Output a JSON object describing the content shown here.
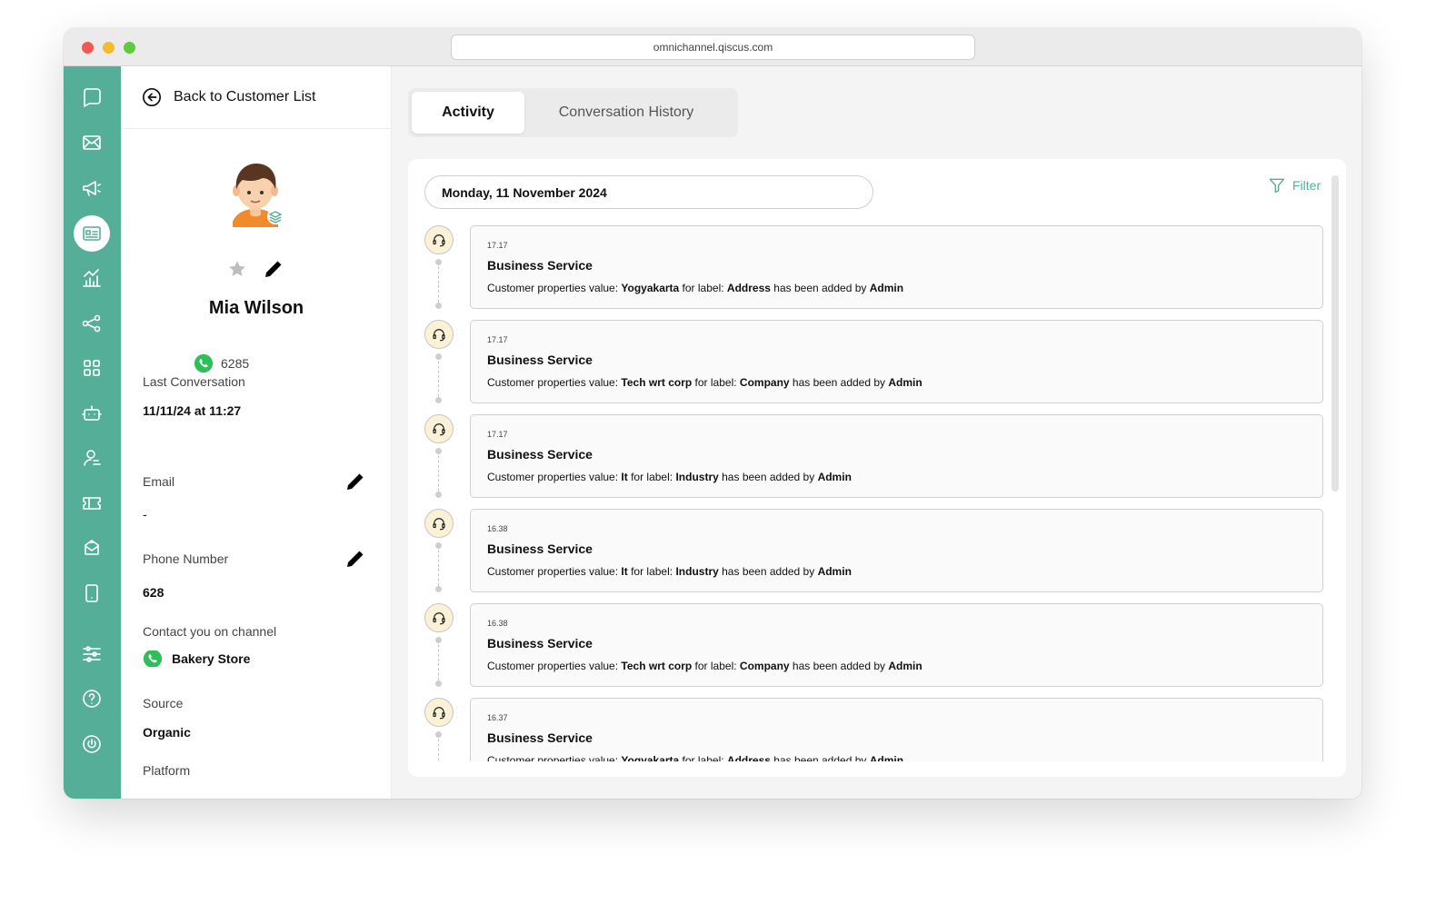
{
  "browser": {
    "url": "omnichannel.qiscus.com"
  },
  "colors": {
    "brand": "#55ae98",
    "rail": "#55ae98",
    "badge_bg": "#fbf1d6"
  },
  "rail": {
    "icons": [
      "chat-bubble-icon",
      "inbox-icon",
      "megaphone-icon",
      "contact-card-icon",
      "analytics-icon",
      "integration-icon",
      "apps-grid-icon",
      "bot-icon",
      "agent-icon",
      "ticket-icon",
      "mailbox-icon",
      "mobile-icon",
      "settings-sliders-icon",
      "help-icon",
      "power-icon"
    ],
    "active": "contact-card-icon"
  },
  "customer": {
    "back_label": "Back to Customer List",
    "name": "Mia Wilson",
    "phone_short": "6285",
    "last_conversation_label": "Last Conversation",
    "last_conversation_value": "11/11/24 at 11:27",
    "email_label": "Email",
    "email_value": "-",
    "phone_label": "Phone Number",
    "phone_value": "628",
    "channel_label": "Contact you on channel",
    "channel_value": "Bakery Store",
    "source_label": "Source",
    "source_value": "Organic",
    "platform_label": "Platform",
    "platform_value": "-"
  },
  "tabs": {
    "activity": "Activity",
    "history": "Conversation History",
    "active": "Activity"
  },
  "activity": {
    "date": "Monday, 11 November 2024",
    "filter_label": "Filter",
    "prefix": "Customer properties value: ",
    "for_label": " for label: ",
    "suffix": " has been added by ",
    "entries": [
      {
        "time": "17.17",
        "title": "Business Service",
        "value": "Yogyakarta",
        "label": "Address",
        "by": "Admin"
      },
      {
        "time": "17.17",
        "title": "Business Service",
        "value": "Tech wrt corp",
        "label": "Company",
        "by": "Admin"
      },
      {
        "time": "17.17",
        "title": "Business Service",
        "value": "It",
        "label": "Industry",
        "by": "Admin"
      },
      {
        "time": "16.38",
        "title": "Business Service",
        "value": "It",
        "label": "Industry",
        "by": "Admin"
      },
      {
        "time": "16.38",
        "title": "Business Service",
        "value": "Tech wrt corp",
        "label": "Company",
        "by": "Admin"
      },
      {
        "time": "16.37",
        "title": "Business Service",
        "value": "Yogyakarta",
        "label": "Address",
        "by": "Admin"
      }
    ]
  }
}
